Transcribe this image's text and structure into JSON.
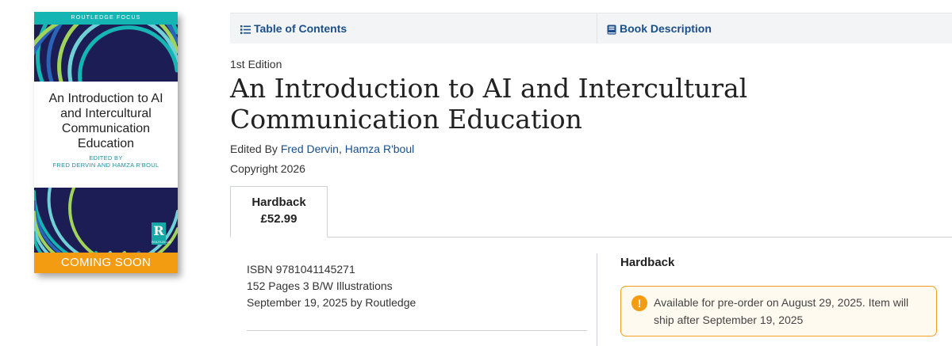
{
  "cover": {
    "series": "ROUTLEDGE FOCUS",
    "title": "An Introduction to AI and Intercultural Communication Education",
    "editors_line1": "EDITED BY",
    "editors_line2": "FRED DERVIN AND HAMZA R'BOUL",
    "logo_letter": "R",
    "logo_text": "ROUTLEDGE",
    "banner": "COMING SOON",
    "colors": {
      "navy": "#1d1d55",
      "teal": "#14b5b3",
      "orange": "#f39c12"
    }
  },
  "tabs": [
    {
      "label": "Table of Contents",
      "icon": "list-icon"
    },
    {
      "label": "Book Description",
      "icon": "book-icon"
    }
  ],
  "book": {
    "edition": "1st Edition",
    "title": "An Introduction to AI and Intercultural Communication Education",
    "edited_by_label": "Edited By",
    "editors": [
      "Fred Dervin",
      "Hamza R'boul"
    ],
    "editor_separator": ",",
    "copyright": "Copyright 2026"
  },
  "format": {
    "name": "Hardback",
    "price": "£52.99"
  },
  "details": {
    "isbn": "ISBN 9781041145271",
    "pages": "152 Pages 3 B/W Illustrations",
    "published": "September 19, 2025 by Routledge"
  },
  "availability": {
    "heading": "Hardback",
    "icon": "exclamation-icon",
    "icon_glyph": "!",
    "message": "Available for pre-order on August 29, 2025. Item will ship after September 19, 2025",
    "accent": "#f39c12",
    "link_color": "#1a4f8b"
  }
}
